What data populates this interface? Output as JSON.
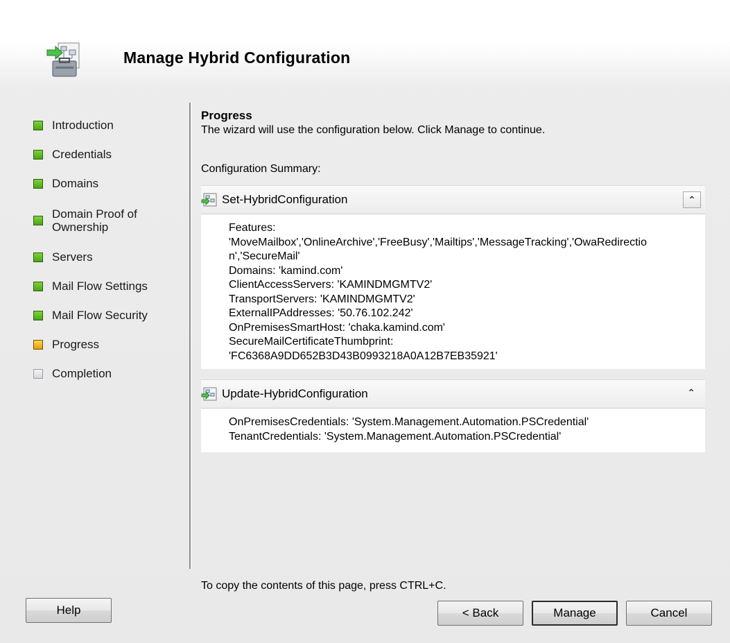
{
  "window": {
    "title": "Manage Hybrid Configuration"
  },
  "steps": [
    {
      "label": "Introduction",
      "state": "complete"
    },
    {
      "label": "Credentials",
      "state": "complete"
    },
    {
      "label": "Domains",
      "state": "complete"
    },
    {
      "label": "Domain Proof of Ownership",
      "state": "complete"
    },
    {
      "label": "Servers",
      "state": "complete"
    },
    {
      "label": "Mail Flow Settings",
      "state": "complete"
    },
    {
      "label": "Mail Flow Security",
      "state": "complete"
    },
    {
      "label": "Progress",
      "state": "current"
    },
    {
      "label": "Completion",
      "state": "pending"
    }
  ],
  "main": {
    "section_title": "Progress",
    "instructions": "The wizard will use the configuration below.  Click Manage to continue.",
    "summary_label": "Configuration Summary:"
  },
  "panels": [
    {
      "command": "Set-HybridConfiguration",
      "collapse_icon": "double-chevron-up",
      "lines": [
        "Features:",
        "'MoveMailbox','OnlineArchive','FreeBusy','Mailtips','MessageTracking','OwaRedirectio",
        "n','SecureMail'",
        "Domains: 'kamind.com'",
        "ClientAccessServers: 'KAMINDMGMTV2'",
        "TransportServers: 'KAMINDMGMTV2'",
        "ExternalIPAddresses: '50.76.102.242'",
        "OnPremisesSmartHost: 'chaka.kamind.com'",
        "SecureMailCertificateThumbprint:",
        "'FC6368A9DD652B3D43B0993218A0A12B7EB35921'"
      ]
    },
    {
      "command": "Update-HybridConfiguration",
      "collapse_icon": "double-chevron-up",
      "lines": [
        "OnPremisesCredentials: 'System.Management.Automation.PSCredential'",
        "TenantCredentials: 'System.Management.Automation.PSCredential'"
      ]
    }
  ],
  "footer": {
    "copy_hint": "To copy the contents of this page, press CTRL+C.",
    "help_label": "Help",
    "back_label": "< Back",
    "manage_label": "Manage",
    "cancel_label": "Cancel"
  },
  "colors": {
    "step_complete": "#5cb827",
    "step_current": "#f0b400",
    "step_pending": "#e0e0e0"
  }
}
